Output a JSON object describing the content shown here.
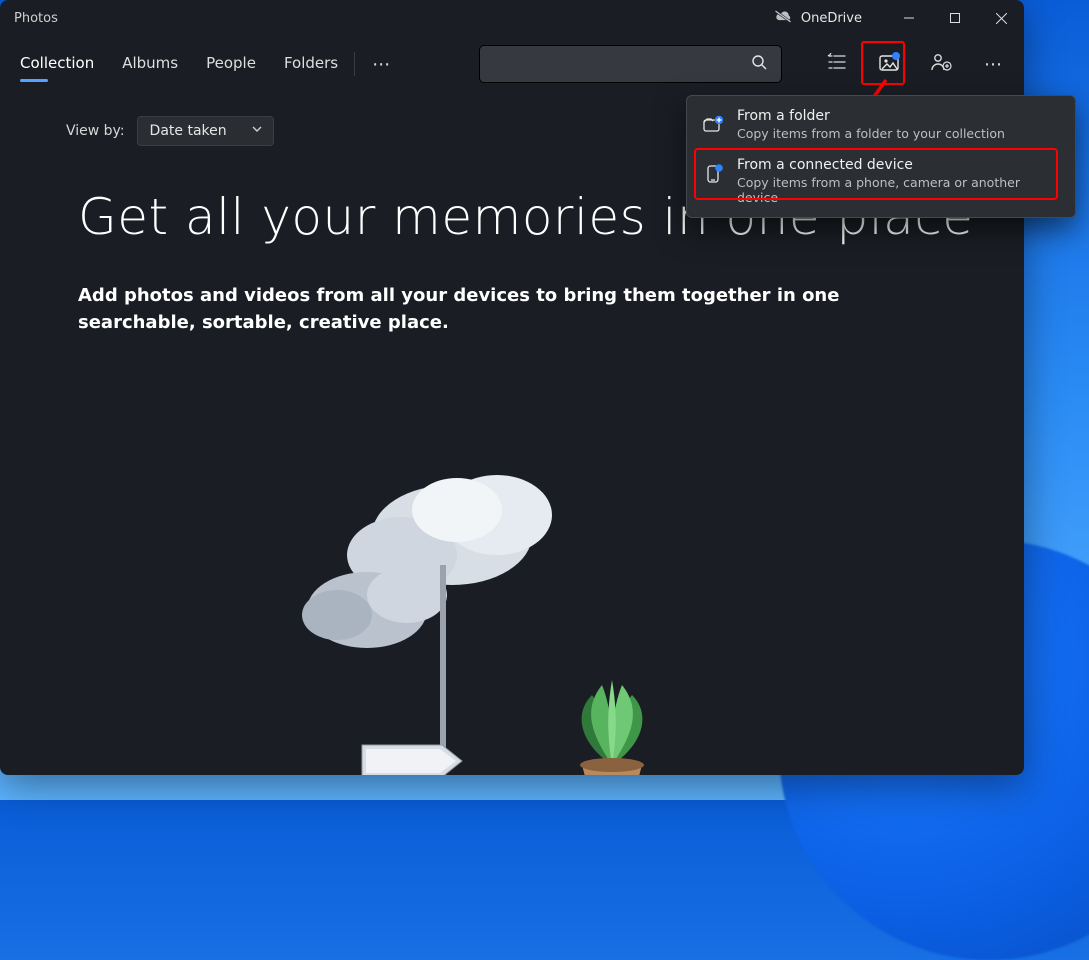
{
  "window": {
    "title": "Photos"
  },
  "titlebar": {
    "onedrive_label": "OneDrive"
  },
  "tabs": {
    "items": [
      {
        "label": "Collection"
      },
      {
        "label": "Albums"
      },
      {
        "label": "People"
      },
      {
        "label": "Folders"
      }
    ],
    "active_index": 0
  },
  "search": {
    "placeholder": ""
  },
  "toolbar": {
    "icons": {
      "select": "select-icon",
      "import": "import-icon",
      "people": "people-add-icon",
      "more": "more-icon"
    }
  },
  "viewby": {
    "label": "View by:",
    "selected": "Date taken"
  },
  "headline": "Get all your memories in one place",
  "subheadline": "Add photos and videos from all your devices to bring them together in one searchable, sortable, creative place.",
  "import_menu": {
    "items": [
      {
        "icon": "folder-add-icon",
        "title": "From a folder",
        "desc": "Copy items from a folder to your collection"
      },
      {
        "icon": "device-icon",
        "title": "From a connected device",
        "desc": "Copy items from a phone, camera or another device"
      }
    ],
    "highlighted_index": 1
  },
  "annotations": {
    "highlight_import_button": true,
    "highlight_menu_item": true,
    "arrow_color": "#ff0000"
  }
}
